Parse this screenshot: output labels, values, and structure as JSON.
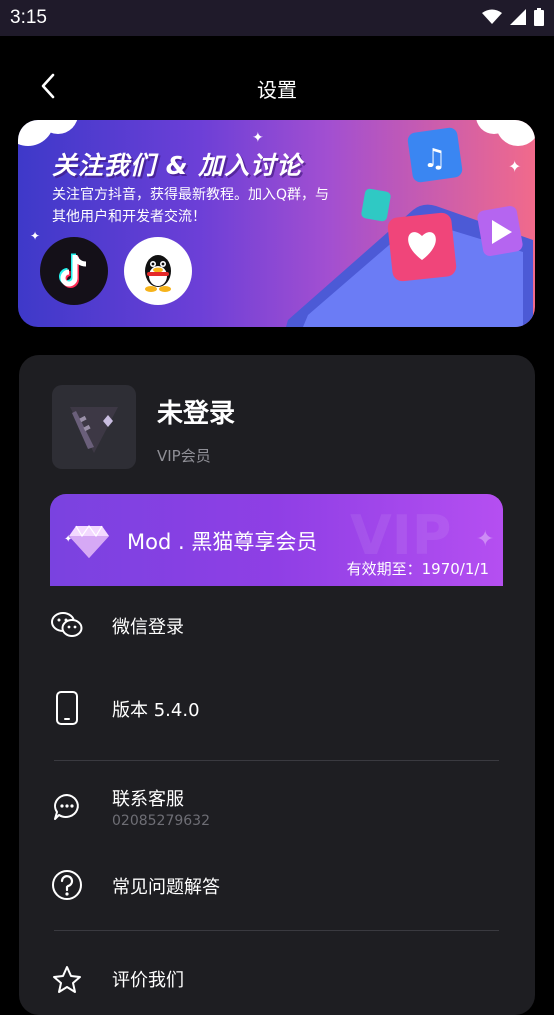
{
  "status_bar": {
    "time": "3:15"
  },
  "header": {
    "title": "设置"
  },
  "banner": {
    "heading": "关注我们 & 加入讨论",
    "description": "关注官方抖音，获得最新教程。加入Q群，与其他用户和开发者交流！",
    "buttons": [
      "douyin-logo",
      "qq-logo"
    ]
  },
  "user": {
    "name": "未登录",
    "subtitle": "VIP会员"
  },
  "vip_card": {
    "title": "Mod . 黑猫尊享会员",
    "expiry": "有效期至：1970/1/1"
  },
  "menu": {
    "wechat_login": "微信登录",
    "version": "版本 5.4.0",
    "contact": "联系客服",
    "contact_phone": "02085279632",
    "faq": "常见问题解答",
    "rate": "评价我们"
  },
  "colors": {
    "background": "#000000",
    "card": "#1e1e22",
    "accent_purple": "#8f3fe5",
    "muted_text": "#8f8f96"
  }
}
